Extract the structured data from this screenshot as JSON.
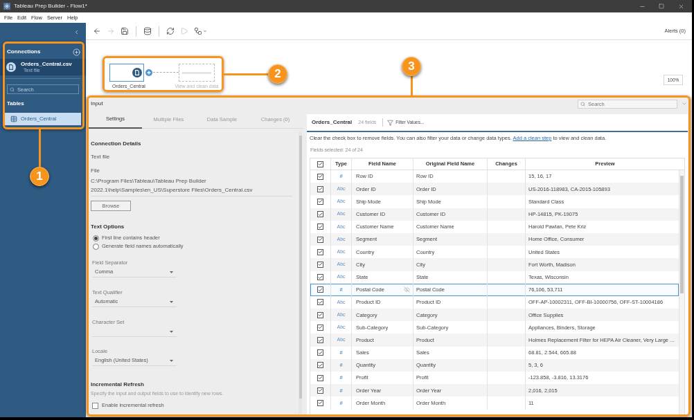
{
  "window": {
    "title": "Tableau Prep Builder - Flow1*"
  },
  "menu": [
    "File",
    "Edit",
    "Flow",
    "Server",
    "Help"
  ],
  "sidebar": {
    "connections_heading": "Connections",
    "connections": [
      {
        "name": "Orders_Central.csv",
        "subtitle": "Text file",
        "selected": true
      }
    ],
    "search": {
      "placeholder": "Search"
    },
    "tables_heading": "Tables",
    "tables": [
      {
        "name": "Orders_Central",
        "selected": true
      }
    ]
  },
  "toolbar": {
    "tools": [
      {
        "kind": "back",
        "disabled": false
      },
      {
        "kind": "forward",
        "disabled": true
      },
      {
        "kind": "save",
        "disabled": false
      },
      {
        "kind": "separator"
      },
      {
        "kind": "connect",
        "disabled": false
      },
      {
        "kind": "separator"
      },
      {
        "kind": "refresh",
        "disabled": false
      },
      {
        "kind": "run",
        "disabled": true
      },
      {
        "kind": "flow",
        "disabled": false
      }
    ],
    "alerts": "Alerts (0)"
  },
  "flow": {
    "nodes": [
      {
        "kind": "input",
        "label": "Orders_Central",
        "selected": true
      },
      {
        "kind": "placeholder",
        "label": "View and clean data",
        "selected": false
      }
    ],
    "zoom": "100%"
  },
  "input_panel": {
    "title": "Input",
    "search": {
      "placeholder": "Search"
    },
    "tabs": [
      {
        "label": "Settings",
        "selected": true
      },
      {
        "label": "Multiple Files",
        "selected": false
      },
      {
        "label": "Data Sample",
        "selected": false
      },
      {
        "label": "Changes (0)",
        "selected": false
      }
    ],
    "settings": {
      "connection_heading": "Connection Details",
      "connection_type": "Text file",
      "file_label": "File",
      "file_path": "C:\\Program Files\\Tableau\\Tableau Prep Builder 2022.1\\help\\Samples\\en_US\\Superstore Files\\Orders_Central.csv",
      "browse": "Browse",
      "text_options_heading": "Text Options",
      "header_options": [
        {
          "label": "First line contains header",
          "selected": true
        },
        {
          "label": "Generate field names automatically",
          "selected": false
        }
      ],
      "dropdowns": [
        {
          "label": "Field Separator",
          "value": "Comma"
        },
        {
          "label": "Text Qualifier",
          "value": "Automatic"
        },
        {
          "label": "Character Set"
        },
        {
          "label": "Locale",
          "value": "English (United States)"
        }
      ],
      "incremental_heading": "Incremental Refresh",
      "incremental_hint": "Specify the input and output fields to use to identify new rows.",
      "incremental_checkbox": {
        "label": "Enable incremental refresh",
        "checked": false
      }
    }
  },
  "fields_panel": {
    "table_name": "Orders_Central",
    "field_count": "24 fields",
    "filter": "Filter Values...",
    "instructions": "Clear the check box to remove fields. You can also filter your data or change data types.",
    "link": "Add a clean step",
    "instructions_end": "to view and clean data.",
    "selected_count": "Fields selected: 24 of 24",
    "select_all": {
      "checked": true
    },
    "columns": [
      "Type",
      "Field Name",
      "Original Field Name",
      "Changes",
      "Preview"
    ],
    "rows": [
      {
        "checked": true,
        "type": "#",
        "field_name": "Row ID",
        "original_field_name": "Row ID",
        "preview": "15, 16, 17",
        "selected": false
      },
      {
        "checked": true,
        "type": "Abc",
        "field_name": "Order ID",
        "original_field_name": "Order ID",
        "preview": "US-2016-118983, CA-2015-105893",
        "selected": false
      },
      {
        "checked": true,
        "type": "Abc",
        "field_name": "Ship Mode",
        "original_field_name": "Ship Mode",
        "preview": "Standard Class",
        "selected": false
      },
      {
        "checked": true,
        "type": "Abc",
        "field_name": "Customer ID",
        "original_field_name": "Customer ID",
        "preview": "HP-14815, PK-19075",
        "selected": false
      },
      {
        "checked": true,
        "type": "Abc",
        "field_name": "Customer Name",
        "original_field_name": "Customer Name",
        "preview": "Harold Pawlan, Pete Kriz",
        "selected": false
      },
      {
        "checked": true,
        "type": "Abc",
        "field_name": "Segment",
        "original_field_name": "Segment",
        "preview": "Home Office, Consumer",
        "selected": false
      },
      {
        "checked": true,
        "type": "Abc",
        "field_name": "Country",
        "original_field_name": "Country",
        "preview": "United States",
        "selected": false
      },
      {
        "checked": true,
        "type": "Abc",
        "field_name": "City",
        "original_field_name": "City",
        "preview": "Fort Worth, Madison",
        "selected": false
      },
      {
        "checked": true,
        "type": "Abc",
        "field_name": "State",
        "original_field_name": "State",
        "preview": "Texas, Wisconsin",
        "selected": false
      },
      {
        "checked": true,
        "type": "#",
        "field_name": "Postal Code",
        "original_field_name": "Postal Code",
        "preview": "76,106, 53,711",
        "selected": true
      },
      {
        "checked": true,
        "type": "Abc",
        "field_name": "Product ID",
        "original_field_name": "Product ID",
        "preview": "OFF-AP-10002311, OFF-BI-10000756, OFF-ST-10004186",
        "selected": false
      },
      {
        "checked": true,
        "type": "Abc",
        "field_name": "Category",
        "original_field_name": "Category",
        "preview": "Office Supplies",
        "selected": false
      },
      {
        "checked": true,
        "type": "Abc",
        "field_name": "Sub-Category",
        "original_field_name": "Sub-Category",
        "preview": "Appliances, Binders, Storage",
        "selected": false
      },
      {
        "checked": true,
        "type": "Abc",
        "field_name": "Product",
        "original_field_name": "Product",
        "preview": "Holmes Replacement Filter for HEPA Air Cleaner, Very Large ...",
        "selected": false
      },
      {
        "checked": true,
        "type": "#",
        "field_name": "Sales",
        "original_field_name": "Sales",
        "preview": "68.81, 2.544, 665.88",
        "selected": false
      },
      {
        "checked": true,
        "type": "#",
        "field_name": "Quantity",
        "original_field_name": "Quantity",
        "preview": "5, 3, 6",
        "selected": false
      },
      {
        "checked": true,
        "type": "#",
        "field_name": "Profit",
        "original_field_name": "Profit",
        "preview": "-123.858, -3.816, 13.3176",
        "selected": false
      },
      {
        "checked": true,
        "type": "#",
        "field_name": "Order Year",
        "original_field_name": "Order Year",
        "preview": "2,016, 2,015",
        "selected": false
      },
      {
        "checked": true,
        "type": "#",
        "field_name": "Order Month",
        "original_field_name": "Order Month",
        "preview": "11",
        "selected": false
      }
    ]
  },
  "callouts": [
    {
      "number": "1"
    },
    {
      "number": "2"
    },
    {
      "number": "3"
    }
  ]
}
